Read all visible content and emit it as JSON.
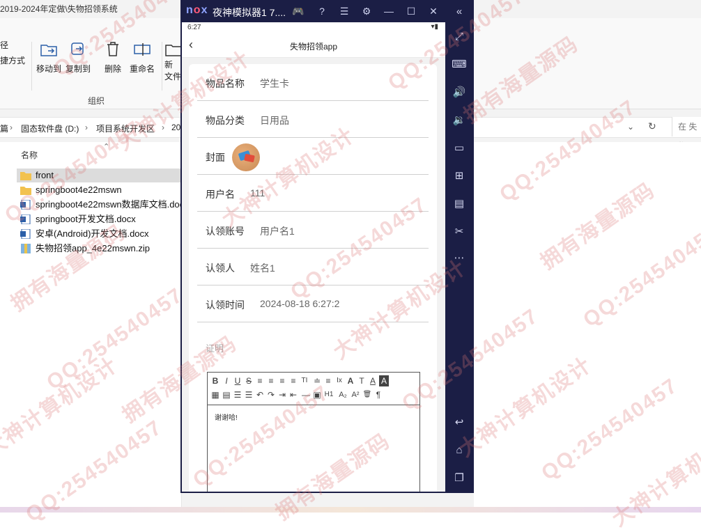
{
  "explorer": {
    "title": "2019-2024年定做\\失物招领系统",
    "ribbon": {
      "left_items": [
        "径",
        "捷方式"
      ],
      "move_to": "移动到",
      "copy_to": "复制到",
      "delete": "删除",
      "rename": "重命名",
      "new": "新",
      "new_sub": "文件",
      "group": "组织"
    },
    "breadcrumb": [
      "篇",
      "固态软件盘 (D:)",
      "项目系统开发区",
      "20"
    ],
    "search_placeholder": "在 失物",
    "column_name": "名称",
    "files": [
      {
        "name": "front",
        "type": "folder"
      },
      {
        "name": "springboot4e22mswn",
        "type": "folder"
      },
      {
        "name": "springboot4e22mswn数据库文档.docx",
        "type": "word"
      },
      {
        "name": "springboot开发文档.docx",
        "type": "word"
      },
      {
        "name": "安卓(Android)开发文档.docx",
        "type": "word"
      },
      {
        "name": "失物招领app_4e22mswn.zip",
        "type": "zip"
      }
    ]
  },
  "emulator": {
    "logo": "nox",
    "title": "夜神模拟器1 7....",
    "status_time": "6:27",
    "app": {
      "title": "失物招领app",
      "fields": [
        {
          "label": "物品名称",
          "value": "学生卡"
        },
        {
          "label": "物品分类",
          "value": "日用品"
        },
        {
          "label": "封面",
          "value": ""
        },
        {
          "label": "用户名",
          "value": "111"
        },
        {
          "label": "认领账号",
          "value": "用户名1"
        },
        {
          "label": "认领人",
          "value": "姓名1"
        },
        {
          "label": "认领时间",
          "value": "2024-08-18 6:27:2"
        }
      ],
      "proof_label": "证明",
      "editor_content": "谢谢哈!",
      "toolbar_row1": [
        "B",
        "I",
        "U",
        "S",
        "≡",
        "≡",
        "≡",
        "≡",
        "TI",
        "≐",
        "≡",
        "Ix",
        "A",
        "T",
        "A",
        "A"
      ],
      "toolbar_row2": [
        "▦",
        "▤",
        "☰",
        "☰",
        "↶",
        "↷",
        "⇥",
        "⇤",
        "—",
        "▣",
        "H1",
        "A₂",
        "A²",
        "🗑",
        "¶"
      ]
    }
  },
  "watermark_texts": [
    "QQ:254540457",
    "拥有海量源码",
    "大神计算机设计"
  ],
  "colors": {
    "nox_bg": "#1b1e45",
    "accent": "#ff5a7a"
  }
}
